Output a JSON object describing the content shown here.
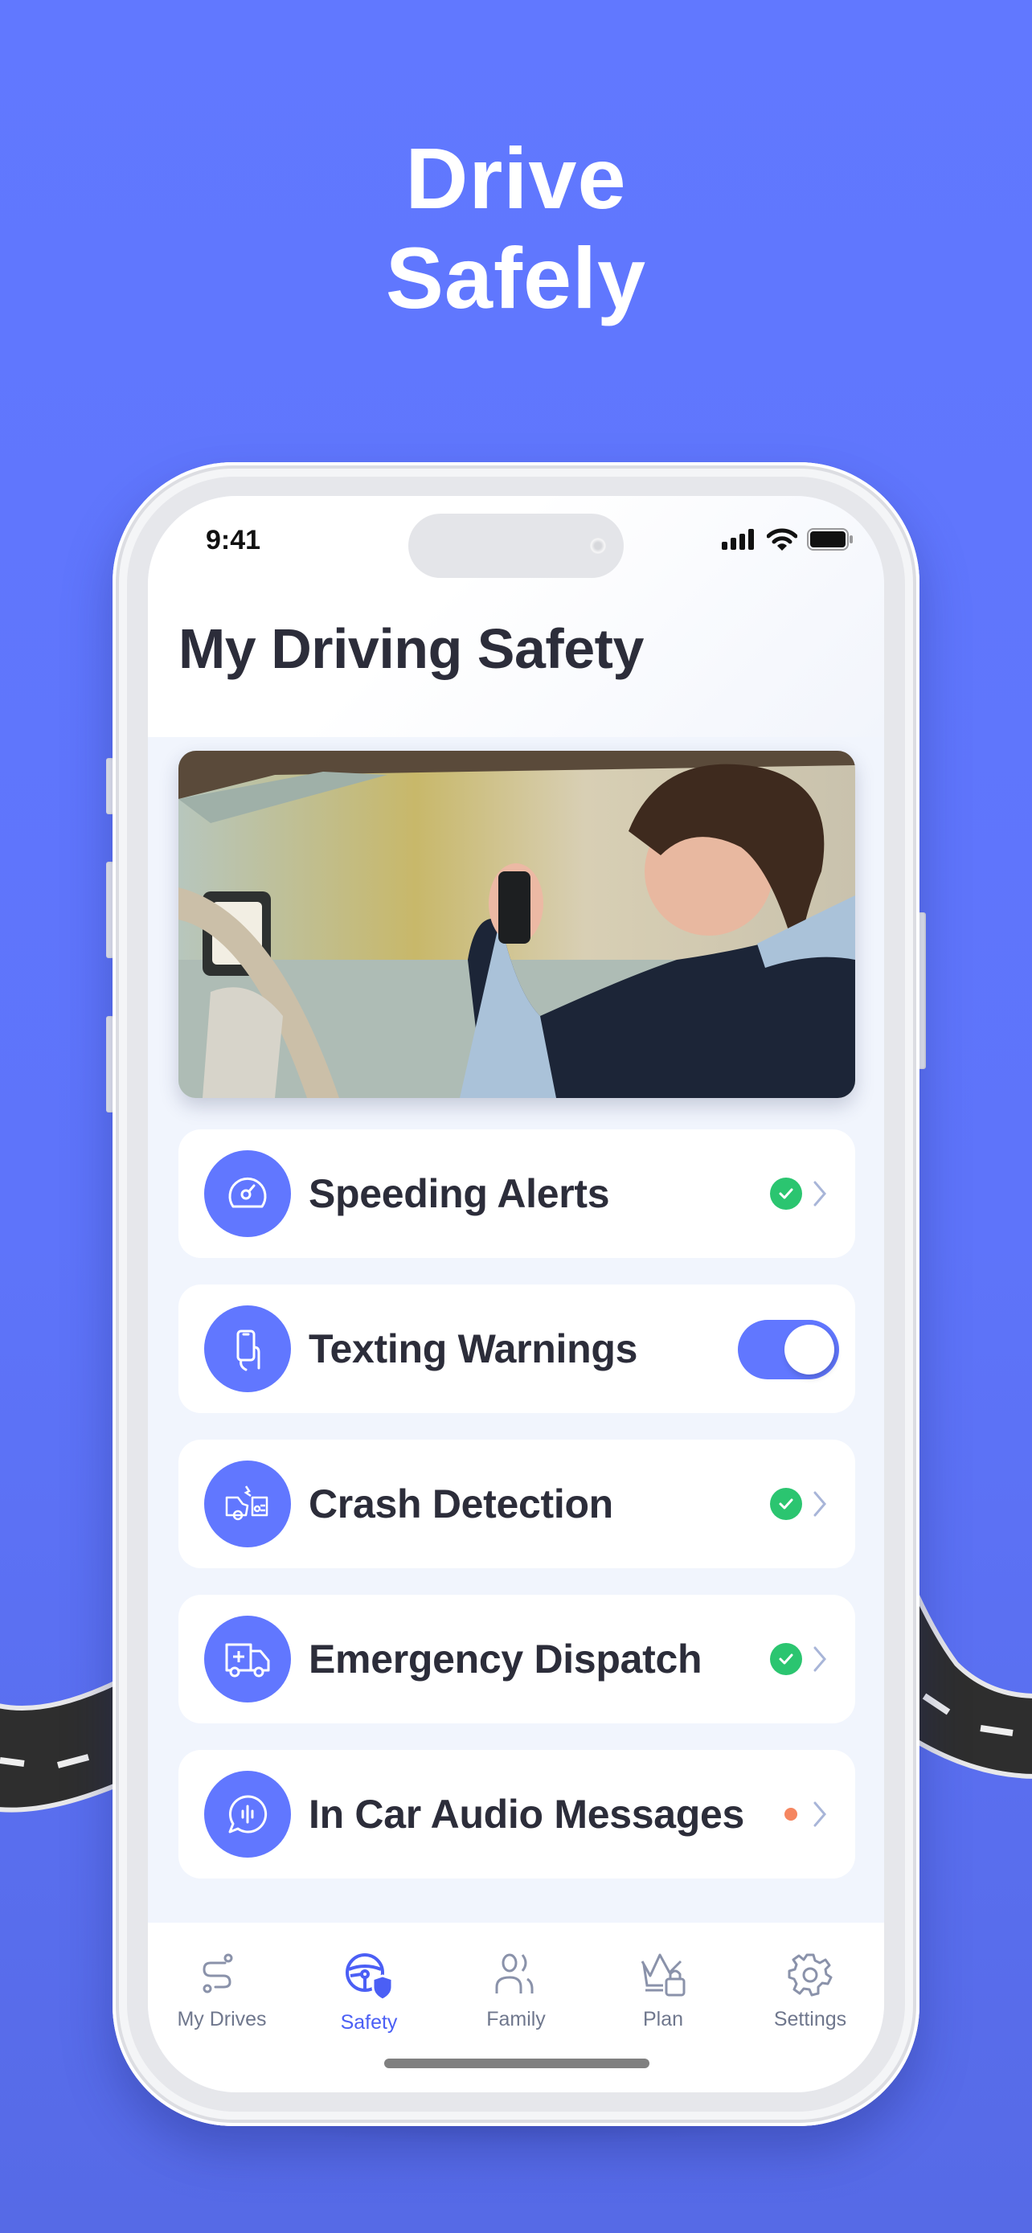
{
  "hero": {
    "line1": "Drive",
    "line2": "Safely"
  },
  "colors": {
    "background": "#6178ff",
    "accent": "#6177ff",
    "active_tab": "#4b5ff5",
    "check_green": "#2bc570",
    "pending_orange": "#f58660",
    "title_text": "#2c2d3a",
    "inactive_tab": "#6f778d"
  },
  "status_bar": {
    "time": "9:41",
    "icons": [
      "cellular-signal-icon",
      "wifi-icon",
      "battery-icon"
    ]
  },
  "screen": {
    "title": "My Driving Safety",
    "hero_image": "teen-driver-holding-car-keys-photo"
  },
  "features": [
    {
      "label": "Speeding Alerts",
      "icon": "speedometer-icon",
      "status": "enabled",
      "control": "check-chevron"
    },
    {
      "label": "Texting Warnings",
      "icon": "phone-in-hand-icon",
      "status": "on",
      "control": "toggle"
    },
    {
      "label": "Crash Detection",
      "icon": "car-crash-icon",
      "status": "enabled",
      "control": "check-chevron"
    },
    {
      "label": "Emergency Dispatch",
      "icon": "ambulance-icon",
      "status": "enabled",
      "control": "check-chevron"
    },
    {
      "label": "In Car Audio Messages",
      "icon": "audio-message-icon",
      "status": "pending",
      "control": "dot-chevron"
    }
  ],
  "tabbar": {
    "active": "Safety",
    "tabs": [
      {
        "label": "My Drives",
        "icon": "route-icon"
      },
      {
        "label": "Safety",
        "icon": "steering-wheel-shield-icon"
      },
      {
        "label": "Family",
        "icon": "people-icon"
      },
      {
        "label": "Plan",
        "icon": "crown-lock-icon"
      },
      {
        "label": "Settings",
        "icon": "gear-icon"
      }
    ]
  }
}
